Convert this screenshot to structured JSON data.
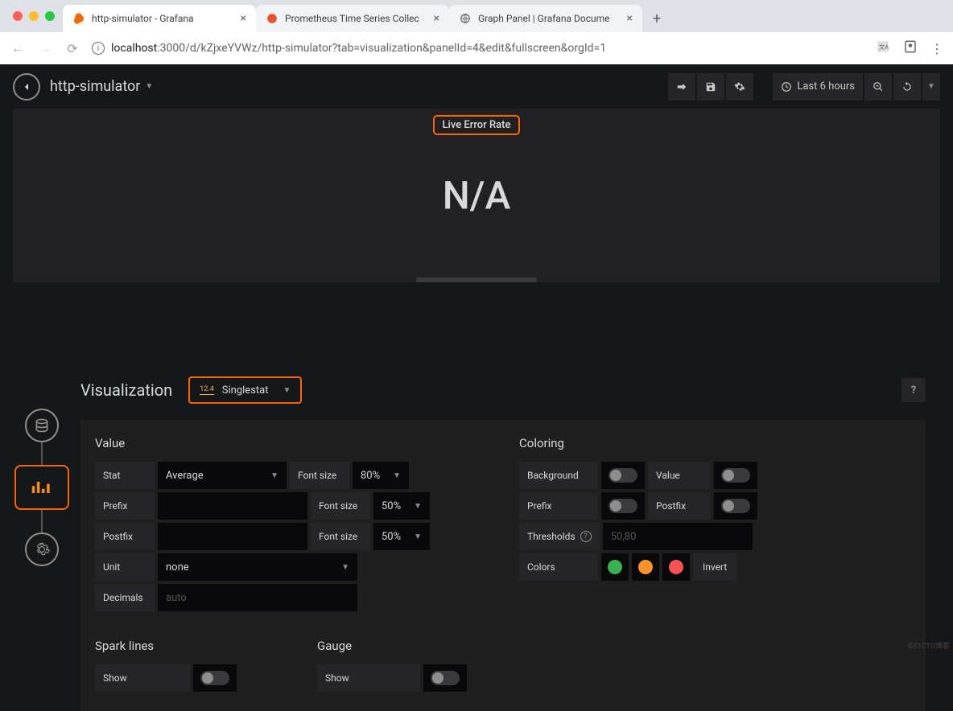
{
  "browser": {
    "tabs": [
      {
        "title": "http-simulator - Grafana"
      },
      {
        "title": "Prometheus Time Series Collec"
      },
      {
        "title": "Graph Panel | Grafana Docume"
      }
    ],
    "url_host": "localhost",
    "url_path": ":3000/d/kZjxeYVWz/http-simulator?tab=visualization&panelId=4&edit&fullscreen&orgId=1"
  },
  "toolbar": {
    "dash_name": "http-simulator",
    "time_range": "Last 6 hours"
  },
  "panel": {
    "title": "Live Error Rate",
    "value": "N/A"
  },
  "editor": {
    "section": "Visualization",
    "viz_badge": "12.4",
    "viz_type": "Singlestat",
    "help": "?",
    "value_group": "Value",
    "coloring_group": "Coloring",
    "sparklines_group": "Spark lines",
    "gauge_group": "Gauge",
    "labels": {
      "stat": "Stat",
      "prefix": "Prefix",
      "postfix": "Postfix",
      "unit": "Unit",
      "decimals": "Decimals",
      "fontsize": "Font size",
      "background": "Background",
      "value": "Value",
      "thresholds": "Thresholds",
      "colors": "Colors",
      "invert": "Invert",
      "show": "Show"
    },
    "values": {
      "stat": "Average",
      "fs1": "80%",
      "fs2": "50%",
      "fs3": "50%",
      "unit": "none",
      "decimals_ph": "auto",
      "thresholds_ph": "50,80"
    },
    "colors": {
      "c1": "#37b24d",
      "c2": "#ff922b",
      "c3": "#fa5252"
    }
  },
  "watermark": "©51CTO博客"
}
